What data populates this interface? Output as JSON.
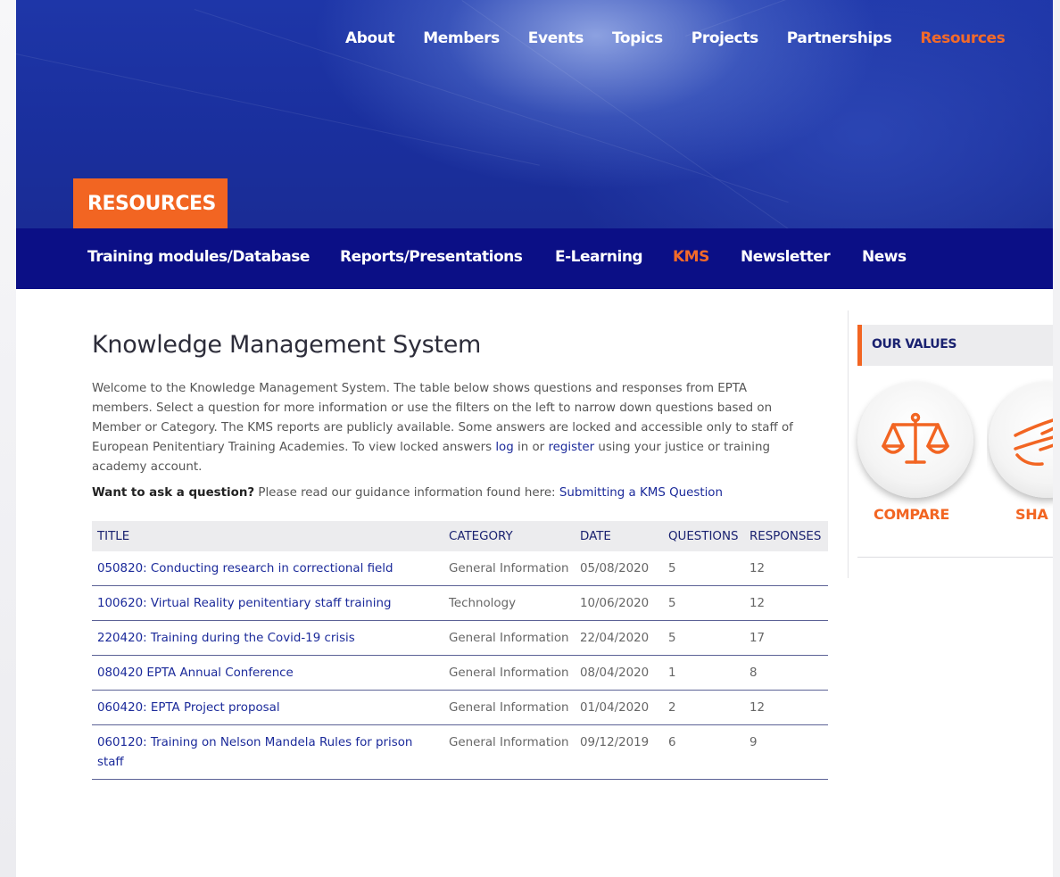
{
  "nav": {
    "items": [
      {
        "label": "About",
        "active": false
      },
      {
        "label": "Members",
        "active": false
      },
      {
        "label": "Events",
        "active": false
      },
      {
        "label": "Topics",
        "active": false
      },
      {
        "label": "Projects",
        "active": false
      },
      {
        "label": "Partnerships",
        "active": false
      },
      {
        "label": "Resources",
        "active": true
      }
    ]
  },
  "section_badge": "RESOURCES",
  "subnav": {
    "items": [
      {
        "label": "Training modules/Database",
        "active": false
      },
      {
        "label": "Reports/Presentations",
        "active": false
      },
      {
        "label": "E-Learning",
        "active": false
      },
      {
        "label": "KMS",
        "active": true
      },
      {
        "label": "Newsletter",
        "active": false
      },
      {
        "label": "News",
        "active": false
      }
    ]
  },
  "page": {
    "title": "Knowledge Management System",
    "intro_part1": "Welcome to the Knowledge Management System. The table below shows questions and responses from EPTA members. Select a question for more information or use the filters on the left to narrow down questions based on Member or Category. The KMS reports are publicly available. Some answers are locked and accessible only to staff of European Penitentiary Training Academies. To view locked answers ",
    "log_link": "log",
    "intro_part2": " in or ",
    "register_link": "register",
    "intro_part3": " using your justice or training academy account.",
    "ask_bold": "Want to ask a question?",
    "ask_text": " Please read our guidance information found here: ",
    "ask_link": "Submitting a KMS Question"
  },
  "table": {
    "headers": [
      "TITLE",
      "CATEGORY",
      "DATE",
      "QUESTIONS",
      "RESPONSES"
    ],
    "rows": [
      {
        "title": "050820: Conducting research in correctional field",
        "category": "General Information",
        "date": "05/08/2020",
        "questions": "5",
        "responses": "12"
      },
      {
        "title": "100620: Virtual Reality penitentiary staff training",
        "category": "Technology",
        "date": "10/06/2020",
        "questions": "5",
        "responses": "12"
      },
      {
        "title": "220420: Training during the Covid-19 crisis",
        "category": "General Information",
        "date": "22/04/2020",
        "questions": "5",
        "responses": "17"
      },
      {
        "title": "080420 EPTA Annual Conference",
        "category": "General Information",
        "date": "08/04/2020",
        "questions": "1",
        "responses": "8"
      },
      {
        "title": "060420: EPTA Project proposal",
        "category": "General Information",
        "date": "01/04/2020",
        "questions": "2",
        "responses": "12"
      },
      {
        "title": "060120: Training on Nelson Mandela Rules for prison staff",
        "category": "General Information",
        "date": "09/12/2019",
        "questions": "6",
        "responses": "9"
      }
    ]
  },
  "sidebar": {
    "heading": "OUR VALUES",
    "values": [
      {
        "label": "COMPARE",
        "icon": "scales-icon"
      },
      {
        "label": "SHA",
        "icon": "hands-icon"
      }
    ]
  },
  "colors": {
    "accent": "#f26522",
    "nav_bg": "#0b0f86",
    "link": "#1b2a9a",
    "hero": "#1e36a8"
  }
}
